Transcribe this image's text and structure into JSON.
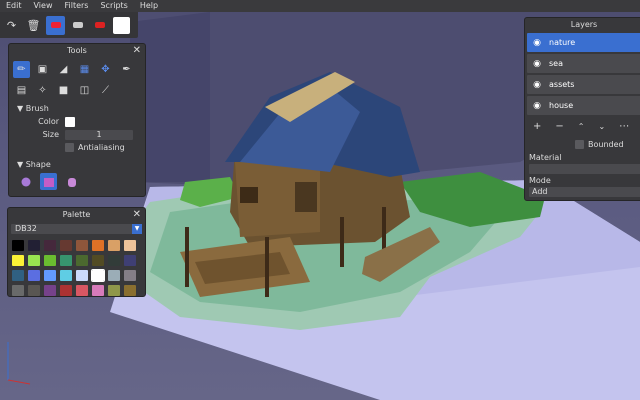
{
  "menu": [
    "Edit",
    "View",
    "Filters",
    "Scripts",
    "Help"
  ],
  "toolbar": {
    "icons": [
      "redo-icon",
      "trash-icon",
      "paint-bucket-icon",
      "eraser-icon",
      "brush-red-icon",
      "color-swatch-icon"
    ],
    "current_color": "#ffffff"
  },
  "tools": {
    "title": "Tools",
    "brush_header": "Brush",
    "color_label": "Color",
    "size_label": "Size",
    "size_value": "1",
    "antialias_label": "Antialiasing",
    "shape_header": "Shape"
  },
  "palette": {
    "title": "Palette",
    "selected": "DB32",
    "colors": [
      "#000000",
      "#222034",
      "#45283c",
      "#663931",
      "#8f563b",
      "#df7126",
      "#d9a066",
      "#eec39a",
      "#fbf236",
      "#99e550",
      "#6abe30",
      "#37946e",
      "#4b692f",
      "#524b24",
      "#323c39",
      "#3f3f74",
      "#306082",
      "#5b6ee1",
      "#639bff",
      "#5fcde4",
      "#cbdbfc",
      "#ffffff",
      "#9badb7",
      "#847e87",
      "#696a6a",
      "#595652",
      "#76428a",
      "#ac3232",
      "#d95763",
      "#d77bba",
      "#8f974a",
      "#8a6f30"
    ],
    "selected_index": 21
  },
  "layers": {
    "title": "Layers",
    "items": [
      {
        "name": "nature",
        "selected": true
      },
      {
        "name": "sea",
        "selected": false
      },
      {
        "name": "assets",
        "selected": false
      },
      {
        "name": "house",
        "selected": false
      }
    ],
    "bounded_label": "Bounded",
    "material_label": "Material",
    "mode_label": "Mode",
    "mode_value": "Add"
  }
}
